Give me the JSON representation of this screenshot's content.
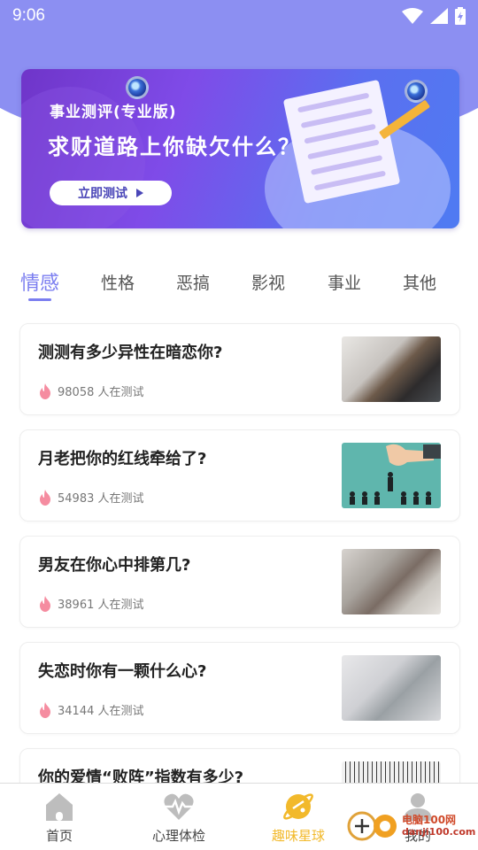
{
  "status_bar": {
    "time": "9:06"
  },
  "banner": {
    "subtitle": "事业测评(专业版)",
    "title": "求财道路上你缺欠什么？",
    "button_label": "立即测试"
  },
  "tabs": [
    {
      "label": "情感",
      "active": true
    },
    {
      "label": "性格",
      "active": false
    },
    {
      "label": "恶搞",
      "active": false
    },
    {
      "label": "影视",
      "active": false
    },
    {
      "label": "事业",
      "active": false
    },
    {
      "label": "其他",
      "active": false
    }
  ],
  "cards": [
    {
      "title": "测测有多少异性在暗恋你?",
      "count": "98058 人在测试"
    },
    {
      "title": "月老把你的红线牵给了?",
      "count": "54983 人在测试"
    },
    {
      "title": "男友在你心中排第几?",
      "count": "38961 人在测试"
    },
    {
      "title": "失恋时你有一颗什么心?",
      "count": "34144 人在测试"
    },
    {
      "title": "你的爱情“败阵”指数有多少?",
      "count": ""
    }
  ],
  "bottom_nav": [
    {
      "label": "首页",
      "icon": "home-icon",
      "active": false
    },
    {
      "label": "心理体检",
      "icon": "heartbeat-icon",
      "active": false
    },
    {
      "label": "趣味星球",
      "icon": "planet-icon",
      "active": true
    },
    {
      "label": "我的",
      "icon": "user-icon",
      "active": false
    }
  ],
  "watermark": {
    "line1": "电脑100网",
    "line2": "danji100.com"
  },
  "colors": {
    "accent": "#7b7ef0",
    "header": "#8c8ff2",
    "nav_active": "#f2b92b",
    "flame": "#f58ca0"
  }
}
